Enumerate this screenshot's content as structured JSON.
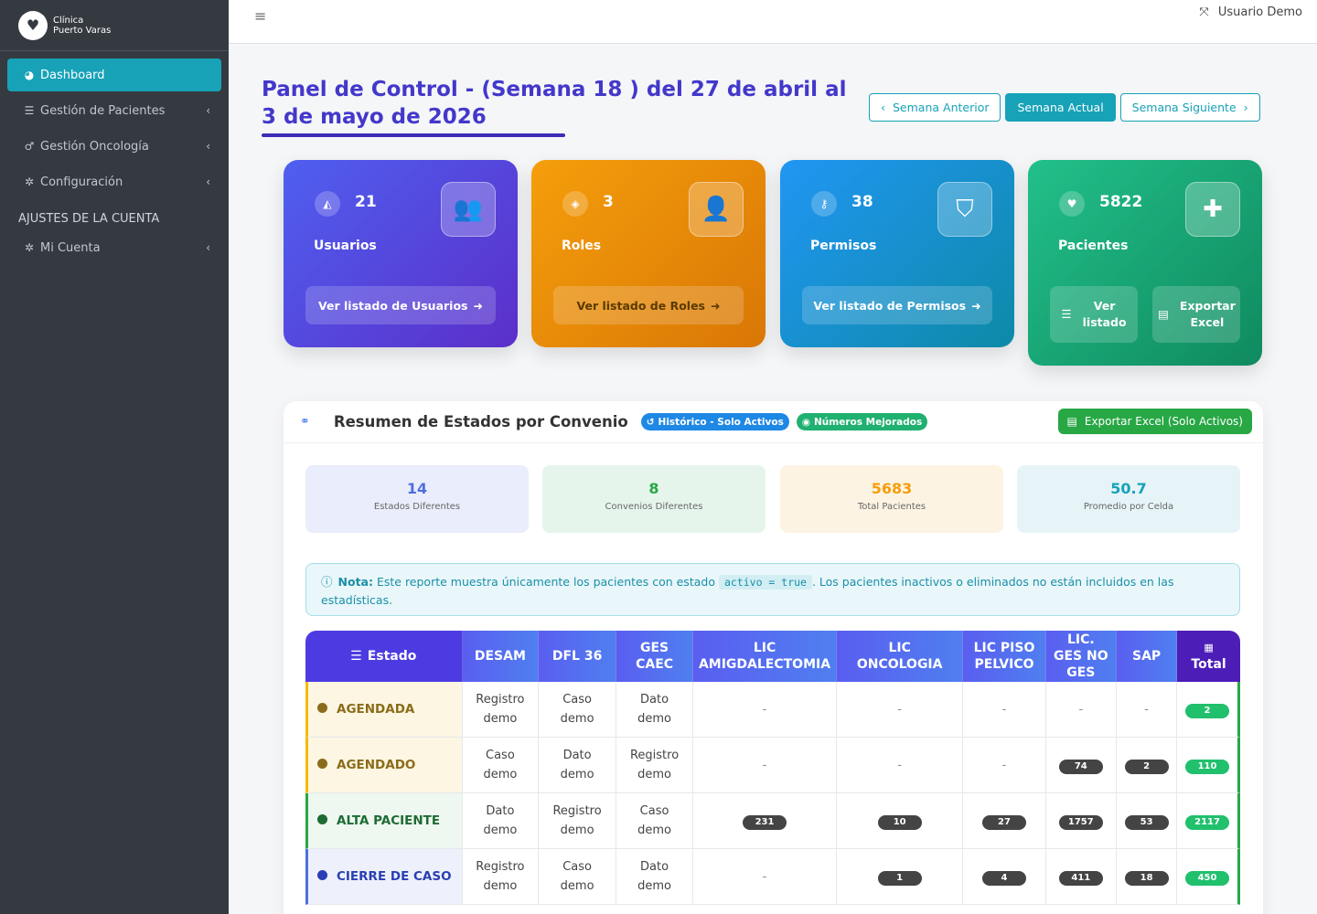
{
  "brand": {
    "line1": "Clínica",
    "line2": "Puerto Varas"
  },
  "sidebar": {
    "items": [
      {
        "label": "Dashboard"
      },
      {
        "label": "Gestión de Pacientes"
      },
      {
        "label": "Gestión Oncología"
      },
      {
        "label": "Configuración"
      }
    ],
    "section": "AJUSTES DE LA CUENTA",
    "account": {
      "label": "Mi Cuenta"
    }
  },
  "topbar": {
    "user": "Usuario Demo"
  },
  "page": {
    "title": "Panel de Control - (Semana 18 ) del 27 de abril al 3 de mayo de 2026",
    "prev": "Semana Anterior",
    "current": "Semana Actual",
    "next": "Semana Siguiente"
  },
  "cards": [
    {
      "count": "21",
      "title": "Usuarios",
      "link": "Ver listado de Usuarios"
    },
    {
      "count": "3",
      "title": "Roles",
      "link": "Ver listado de Roles"
    },
    {
      "count": "38",
      "title": "Permisos",
      "link": "Ver listado de Permisos"
    },
    {
      "count": "5822",
      "title": "Pacientes",
      "link1": "Ver listado",
      "link2": "Exportar Excel"
    }
  ],
  "panel": {
    "title": "Resumen de Estados por Convenio",
    "pill1": "Histórico - Solo Activos",
    "pill2": "Números Mejorados",
    "export": "Exportar Excel (Solo Activos)",
    "stats": [
      {
        "value": "14",
        "label": "Estados Diferentes"
      },
      {
        "value": "8",
        "label": "Convenios Diferentes"
      },
      {
        "value": "5683",
        "label": "Total Pacientes"
      },
      {
        "value": "50.7",
        "label": "Promedio por Celda"
      }
    ],
    "note": {
      "strong": "Nota:",
      "pre": "Este reporte muestra únicamente los pacientes con estado",
      "code": "activo = true",
      "post": ". Los pacientes inactivos o eliminados no están incluidos en las estadísticas."
    },
    "headers": [
      "Estado",
      "DESAM",
      "DFL 36",
      "GES CAEC",
      "LIC AMIGDALECTOMIA",
      "LIC ONCOLOGIA",
      "LIC PISO PELVICO",
      "LIC. GES NO GES",
      "SAP",
      "Total"
    ],
    "rows": [
      {
        "estado": "AGENDADA",
        "color": "#8a6d1a",
        "bg": "#fdf6e3",
        "border": "#f5b800",
        "cells": [
          "Registro demo",
          "Caso demo",
          "Dato demo",
          "-",
          "-",
          "-",
          "-",
          "-"
        ],
        "total": "2"
      },
      {
        "estado": "AGENDADO",
        "color": "#8a6d1a",
        "bg": "#fdf6e3",
        "border": "#f5b800",
        "cells": [
          "Caso demo",
          "Dato demo",
          "Registro demo",
          "-",
          "-",
          "-",
          "74",
          "2"
        ],
        "total": "110"
      },
      {
        "estado": "ALTA PACIENTE",
        "color": "#1e6b34",
        "bg": "#eef7f0",
        "border": "#28a745",
        "cells": [
          "Dato demo",
          "Registro demo",
          "Caso demo",
          "231",
          "10",
          "27",
          "1757",
          "53"
        ],
        "total": "2117"
      },
      {
        "estado": "CIERRE DE CASO",
        "color": "#2a3fb3",
        "bg": "#eef1fb",
        "border": "#4f6fe0",
        "cells": [
          "Registro demo",
          "Caso demo",
          "Dato demo",
          "-",
          "1",
          "4",
          "411",
          "18"
        ],
        "total": "450"
      }
    ]
  },
  "colors": {
    "accent": "#17a2b8",
    "title": "#4338ca",
    "sidebar": "#343a40",
    "success": "#28a745"
  }
}
